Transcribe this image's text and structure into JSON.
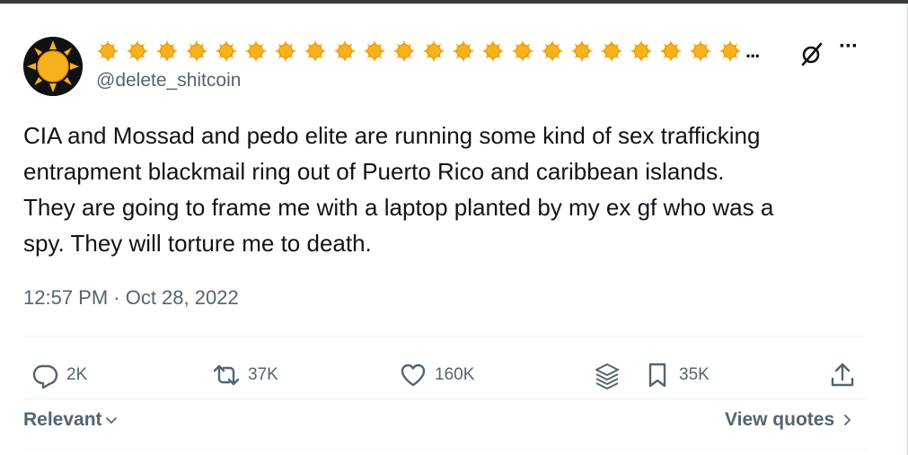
{
  "author": {
    "display_name_emoji": "sun",
    "display_name_emoji_count": 22,
    "display_name_truncation": "...",
    "handle": "@delete_shitcoin",
    "avatar_icon": "sun-avatar-icon"
  },
  "header": {
    "grok_icon": "grok-icon",
    "more_icon": "more-icon",
    "more_label": "···"
  },
  "tweet": {
    "lines": [
      "CIA and Mossad and pedo elite are running some kind of sex trafficking",
      "entrapment blackmail ring out of Puerto Rico and caribbean islands.",
      "They are going to frame me with a laptop planted by my ex gf who was a",
      "spy. They will torture me to death."
    ],
    "timestamp": "12:57 PM · Oct 28, 2022"
  },
  "actions": {
    "reply": {
      "icon": "reply-icon",
      "count": "2K"
    },
    "retweet": {
      "icon": "retweet-icon",
      "count": "37K"
    },
    "like": {
      "icon": "like-icon",
      "count": "160K"
    },
    "stack": {
      "icon": "stack-icon"
    },
    "bookmark": {
      "icon": "bookmark-icon",
      "count": "35K"
    },
    "share": {
      "icon": "share-icon"
    }
  },
  "footer": {
    "sort_label": "Relevant",
    "view_quotes_label": "View quotes"
  },
  "colors": {
    "text": "#0f1419",
    "muted": "#536471",
    "divider": "#eff3f4",
    "sun": "#f7b21b"
  }
}
